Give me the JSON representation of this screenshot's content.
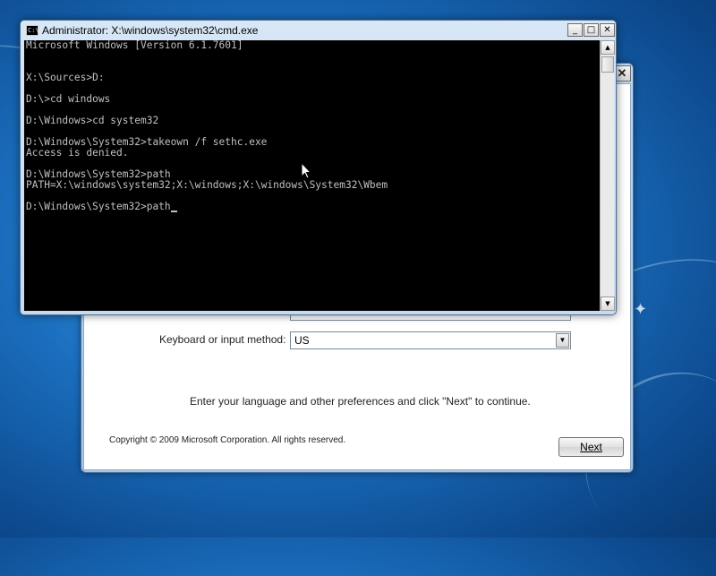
{
  "cmd_window": {
    "title": "Administrator: X:\\windows\\system32\\cmd.exe",
    "icon_text": "C:\\",
    "buttons": {
      "minimize": "_",
      "maximize": "□",
      "close": "✕"
    },
    "console_lines": [
      "Microsoft Windows [Version 6.1.7601]",
      "",
      "",
      "X:\\Sources>D:",
      "",
      "D:\\>cd windows",
      "",
      "D:\\Windows>cd system32",
      "",
      "D:\\Windows\\System32>takeown /f sethc.exe",
      "Access is denied.",
      "",
      "D:\\Windows\\System32>path",
      "PATH=X:\\windows\\system32;X:\\windows;X:\\windows\\System32\\Wbem",
      "",
      "D:\\Windows\\System32>path"
    ],
    "scroll": {
      "up": "▲",
      "down": "▼"
    }
  },
  "setup_window": {
    "close": "✕",
    "keyboard_label": "Keyboard or input method:",
    "keyboard_value": "US",
    "dropdown_arrow": "▼",
    "instruction": "Enter your language and other preferences and click \"Next\" to continue.",
    "copyright": "Copyright © 2009 Microsoft Corporation. All rights reserved.",
    "next_label": "Next"
  },
  "colors": {
    "console_bg": "#000000",
    "console_text": "#c0c0c0",
    "wallpaper": "#1b6fbf"
  }
}
